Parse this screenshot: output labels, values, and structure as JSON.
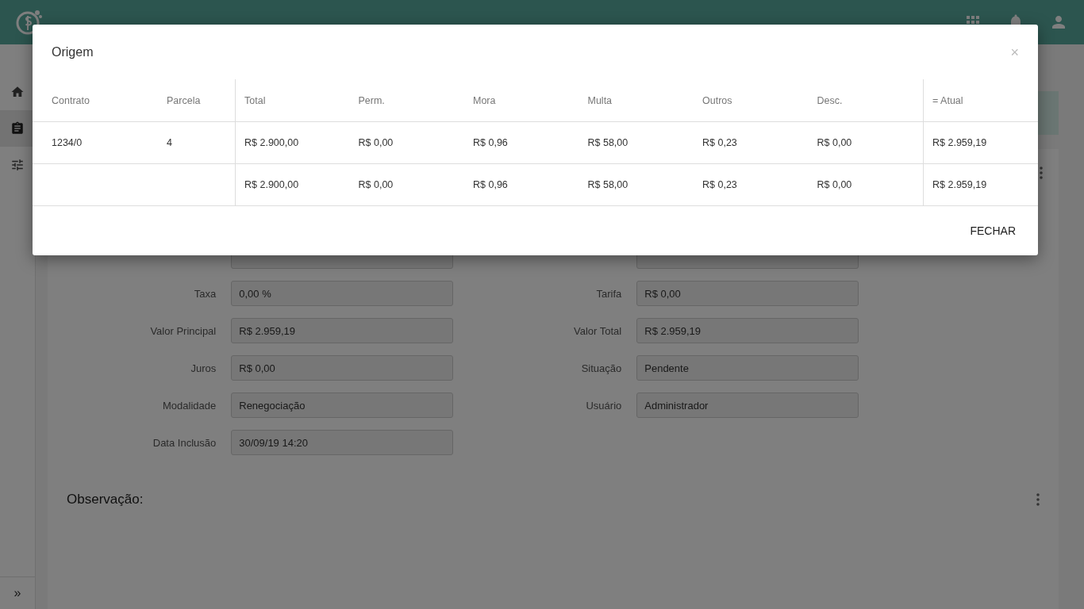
{
  "sidebar": {
    "items": [
      {
        "kind": "home",
        "selected": false
      },
      {
        "kind": "clipboard",
        "selected": true
      },
      {
        "kind": "sliders",
        "selected": false
      }
    ],
    "expand": "»"
  },
  "form": {
    "left": [
      {
        "label": "Taxa",
        "value": "0,00 %"
      },
      {
        "label": "Valor Principal",
        "value": "R$ 2.959,19"
      },
      {
        "label": "Juros",
        "value": "R$ 0,00"
      },
      {
        "label": "Modalidade",
        "value": "Renegociação"
      },
      {
        "label": "Data Inclusão",
        "value": "30/09/19 14:20"
      }
    ],
    "right": [
      {
        "label": "Tarifa",
        "value": "R$ 0,00"
      },
      {
        "label": "Valor Total",
        "value": "R$ 2.959,19"
      },
      {
        "label": "Situação",
        "value": "Pendente"
      },
      {
        "label": "Usuário",
        "value": "Administrador"
      }
    ]
  },
  "observation": {
    "title": "Observação:"
  },
  "dialog": {
    "title": "Origem",
    "close": "×",
    "columns": [
      "Contrato",
      "Parcela",
      "Total",
      "Perm.",
      "Mora",
      "Multa",
      "Outros",
      "Desc.",
      "= Atual"
    ],
    "rows": [
      {
        "contrato": "1234/0",
        "parcela": "4",
        "values": [
          "R$ 2.900,00",
          "R$ 0,00",
          "R$ 0,96",
          "R$ 58,00",
          "R$ 0,23",
          "R$ 0,00",
          "R$ 2.959,19"
        ]
      },
      {
        "values": [
          "R$ 2.900,00",
          "R$ 0,00",
          "R$ 0,96",
          "R$ 58,00",
          "R$ 0,23",
          "R$ 0,00",
          "R$ 2.959,19"
        ]
      }
    ],
    "button": "FECHAR"
  }
}
